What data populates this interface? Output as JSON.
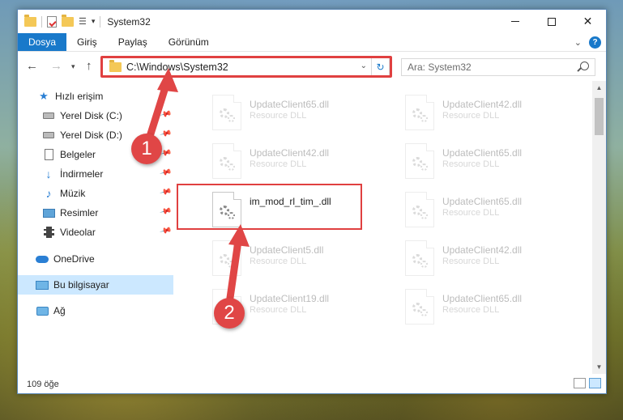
{
  "window": {
    "title": "System32"
  },
  "ribbon": {
    "tabs": [
      "Dosya",
      "Giriş",
      "Paylaş",
      "Görünüm"
    ]
  },
  "address": {
    "path": "C:\\Windows\\System32"
  },
  "search": {
    "placeholder": "Ara: System32"
  },
  "sidebar": {
    "items": [
      {
        "label": "Hızlı erişim",
        "icon": "star-icon"
      },
      {
        "label": "Yerel Disk (C:)",
        "icon": "disk-icon",
        "pinned": true
      },
      {
        "label": "Yerel Disk (D:)",
        "icon": "disk-icon",
        "pinned": true
      },
      {
        "label": "Belgeler",
        "icon": "documents-icon",
        "pinned": true
      },
      {
        "label": "İndirmeler",
        "icon": "downloads-icon",
        "pinned": true
      },
      {
        "label": "Müzik",
        "icon": "music-icon",
        "pinned": true
      },
      {
        "label": "Resimler",
        "icon": "pictures-icon",
        "pinned": true
      },
      {
        "label": "Videolar",
        "icon": "videos-icon",
        "pinned": true
      },
      {
        "label": "OneDrive",
        "icon": "onedrive-icon"
      },
      {
        "label": "Bu bilgisayar",
        "icon": "this-pc-icon",
        "selected": true
      },
      {
        "label": "Ağ",
        "icon": "network-icon"
      }
    ]
  },
  "files": [
    {
      "name": "UpdateClient65.dll",
      "type": "Resource DLL"
    },
    {
      "name": "UpdateClient42.dll",
      "type": "Resource DLL"
    },
    {
      "name": "UpdateClient42.dll",
      "type": "Resource DLL"
    },
    {
      "name": "UpdateClient65.dll",
      "type": "Resource DLL"
    },
    {
      "name": "im_mod_rl_tim_.dll",
      "type": ""
    },
    {
      "name": "UpdateClient65.dll",
      "type": "Resource DLL"
    },
    {
      "name": "UpdateClient5.dll",
      "type": "Resource DLL"
    },
    {
      "name": "UpdateClient42.dll",
      "type": "Resource DLL"
    },
    {
      "name": "UpdateClient19.dll",
      "type": "Resource DLL"
    },
    {
      "name": "UpdateClient65.dll",
      "type": "Resource DLL"
    }
  ],
  "status": {
    "count": "109 öğe"
  },
  "annotations": {
    "step1": "1",
    "step2": "2",
    "color": "#e04646"
  }
}
